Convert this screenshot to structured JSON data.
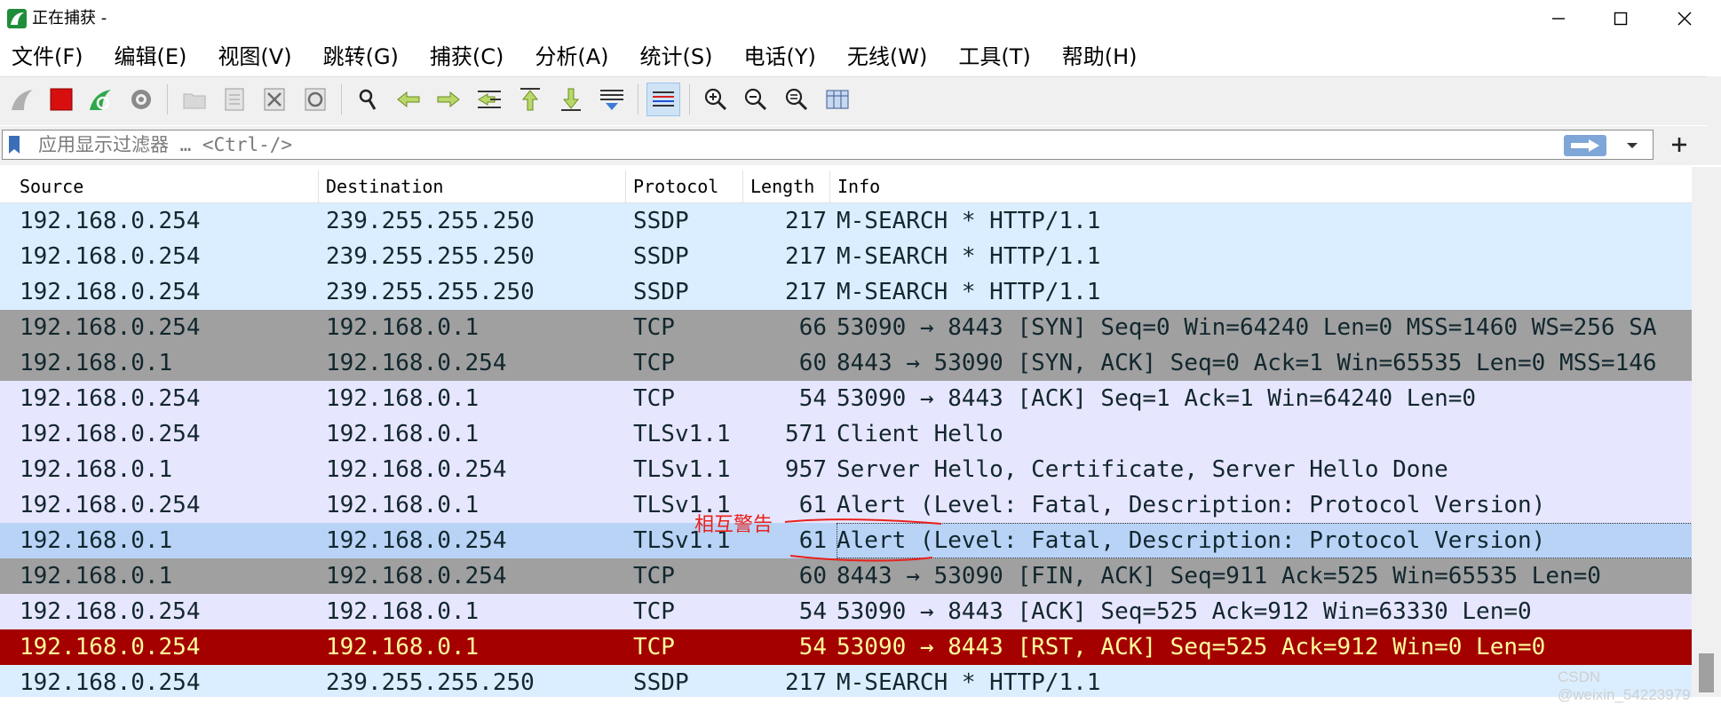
{
  "window": {
    "title": "正在捕获 -",
    "controls": {
      "minimize": "—",
      "maximize": "☐",
      "close": "✕"
    }
  },
  "menu": {
    "items": [
      "文件(F)",
      "编辑(E)",
      "视图(V)",
      "跳转(G)",
      "捕获(C)",
      "分析(A)",
      "统计(S)",
      "电话(Y)",
      "无线(W)",
      "工具(T)",
      "帮助(H)"
    ]
  },
  "toolbar": {
    "icons": [
      "shark-fin-icon",
      "stop-capture-icon",
      "restart-capture-icon",
      "capture-options-icon",
      "open-file-icon",
      "save-file-icon",
      "close-file-icon",
      "reload-file-icon",
      "find-packet-icon",
      "go-back-icon",
      "go-forward-icon",
      "go-to-packet-icon",
      "first-packet-icon",
      "last-packet-icon",
      "auto-scroll-icon",
      "colorize-icon",
      "zoom-in-icon",
      "zoom-out-icon",
      "normal-size-icon",
      "resize-columns-icon"
    ]
  },
  "filter": {
    "placeholder": "应用显示过滤器 … <Ctrl-/>",
    "value": ""
  },
  "columns": [
    "Source",
    "Destination",
    "Protocol",
    "Length",
    "Info"
  ],
  "packets": [
    {
      "source": "192.168.0.254",
      "destination": "239.255.255.250",
      "protocol": "SSDP",
      "length": "217",
      "info": "M-SEARCH * HTTP/1.1",
      "bg": "#daeeff",
      "fg": "#12272e"
    },
    {
      "source": "192.168.0.254",
      "destination": "239.255.255.250",
      "protocol": "SSDP",
      "length": "217",
      "info": "M-SEARCH * HTTP/1.1",
      "bg": "#daeeff",
      "fg": "#12272e"
    },
    {
      "source": "192.168.0.254",
      "destination": "239.255.255.250",
      "protocol": "SSDP",
      "length": "217",
      "info": "M-SEARCH * HTTP/1.1",
      "bg": "#daeeff",
      "fg": "#12272e"
    },
    {
      "source": "192.168.0.254",
      "destination": "192.168.0.1",
      "protocol": "TCP",
      "length": "66",
      "info": "53090 → 8443 [SYN] Seq=0 Win=64240 Len=0 MSS=1460 WS=256 SA",
      "bg": "#a0a0a0",
      "fg": "#12272e"
    },
    {
      "source": "192.168.0.1",
      "destination": "192.168.0.254",
      "protocol": "TCP",
      "length": "60",
      "info": "8443 → 53090 [SYN, ACK] Seq=0 Ack=1 Win=65535 Len=0 MSS=146",
      "bg": "#a0a0a0",
      "fg": "#12272e"
    },
    {
      "source": "192.168.0.254",
      "destination": "192.168.0.1",
      "protocol": "TCP",
      "length": "54",
      "info": "53090 → 8443 [ACK] Seq=1 Ack=1 Win=64240 Len=0",
      "bg": "#e7e6ff",
      "fg": "#12272e"
    },
    {
      "source": "192.168.0.254",
      "destination": "192.168.0.1",
      "protocol": "TLSv1.1",
      "length": "571",
      "info": "Client Hello",
      "bg": "#e7e6ff",
      "fg": "#12272e"
    },
    {
      "source": "192.168.0.1",
      "destination": "192.168.0.254",
      "protocol": "TLSv1.1",
      "length": "957",
      "info": "Server Hello, Certificate, Server Hello Done",
      "bg": "#e7e6ff",
      "fg": "#12272e"
    },
    {
      "source": "192.168.0.254",
      "destination": "192.168.0.1",
      "protocol": "TLSv1.1",
      "length": "61",
      "info": "Alert (Level: Fatal, Description: Protocol Version)",
      "bg": "#e7e6ff",
      "fg": "#12272e"
    },
    {
      "source": "192.168.0.1",
      "destination": "192.168.0.254",
      "protocol": "TLSv1.1",
      "length": "61",
      "info": "Alert (Level: Fatal, Description: Protocol Version)",
      "bg": "#b9d3f7",
      "fg": "#12272e",
      "selected": true
    },
    {
      "source": "192.168.0.1",
      "destination": "192.168.0.254",
      "protocol": "TCP",
      "length": "60",
      "info": "8443 → 53090 [FIN, ACK] Seq=911 Ack=525 Win=65535 Len=0",
      "bg": "#a0a0a0",
      "fg": "#12272e"
    },
    {
      "source": "192.168.0.254",
      "destination": "192.168.0.1",
      "protocol": "TCP",
      "length": "54",
      "info": "53090 → 8443 [ACK] Seq=525 Ack=912 Win=63330 Len=0",
      "bg": "#e7e6ff",
      "fg": "#12272e"
    },
    {
      "source": "192.168.0.254",
      "destination": "192.168.0.1",
      "protocol": "TCP",
      "length": "54",
      "info": "53090 → 8443 [RST, ACK] Seq=525 Ack=912 Win=0 Len=0",
      "bg": "#a40000",
      "fg": "#fffc9c"
    },
    {
      "source": "192.168.0.254",
      "destination": "239.255.255.250",
      "protocol": "SSDP",
      "length": "217",
      "info": "M-SEARCH * HTTP/1.1",
      "bg": "#daeeff",
      "fg": "#12272e"
    }
  ],
  "annotation": {
    "text": "相互警告",
    "color": "#e8211c"
  },
  "watermark": "CSDN @weixin_54223979"
}
